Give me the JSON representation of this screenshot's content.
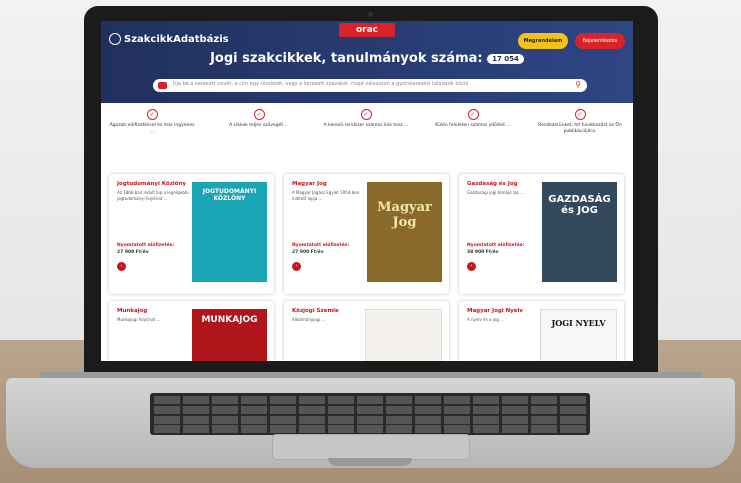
{
  "site": {
    "logo": "SzakcikkAdatbázis",
    "brand": "orac",
    "subscribe_button": "Megrendelem",
    "login_button": "Bejelentkezés",
    "headline": "Jogi szakcikkek, tanulmányok száma:",
    "count": "17 054",
    "search_placeholder": "Írja be a keresett nevét, a cím egy részletét, vagy a keresett szavakat, majd válasszon a gyorskeresési találatok közül"
  },
  "features": [
    "Ágazati elõfizetéssel és már ingyenes ...",
    "A cikkek teljes szövegét ...",
    "A keresõ-rendszer számos link tesz ...",
    "Külön felületen számos jelölést ...",
    "Rendszerünket, hit hivatkozást az Ön publikációjára."
  ],
  "cards": [
    {
      "title": "Jogtudományi Közlöny",
      "desc": "Az 1866-ban indult lap a legrégebbi jogtudományi folyóirat ...",
      "price_label": "Nyomtatott elõfizetés:",
      "price": "27 900 Ft/év",
      "cover_title": "JOGTUDOMÁNYI KÖZLÖNY",
      "cover_color": "#1aa5b4"
    },
    {
      "title": "Magyar Jog",
      "desc": "A Magyar Jogász Egylet 1954-ben indított lapja ...",
      "price_label": "Nyomtatott elõfizetés:",
      "price": "27 900 Ft/év",
      "cover_title": "Magyar Jog",
      "cover_color": "#8a6a2a"
    },
    {
      "title": "Gazdaság és Jog",
      "desc": "Gazdasági jogi témájú lap ...",
      "price_label": "Nyomtatott elõfizetés:",
      "price": "38 900 Ft/év",
      "cover_title": "GAZDASÁG és JOG",
      "cover_color": "#34495e"
    },
    {
      "title": "Munkajog",
      "desc": "Munkajogi folyóirat ...",
      "price_label": "",
      "price": "",
      "cover_title": "MUNKAJOG",
      "cover_color": "#b0151c"
    },
    {
      "title": "Közjogi Szemle",
      "desc": "Alkotmányjogi ...",
      "price_label": "",
      "price": "",
      "cover_title": "",
      "cover_color": "#f4f1ec"
    },
    {
      "title": "Magyar Jogi Nyelv",
      "desc": "A nyelv és a jog ...",
      "price_label": "",
      "price": "",
      "cover_title": "JOGI NYELV",
      "cover_color": "#f7f7f7"
    }
  ]
}
